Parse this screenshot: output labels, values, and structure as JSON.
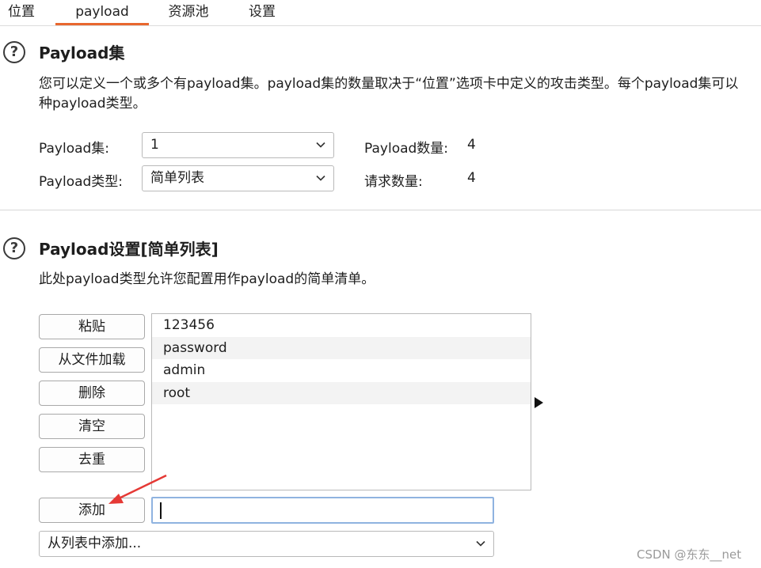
{
  "tabs": [
    {
      "label": "位置",
      "active": false
    },
    {
      "label": "payload",
      "active": true
    },
    {
      "label": "资源池",
      "active": false
    },
    {
      "label": "设置",
      "active": false
    }
  ],
  "payload_sets": {
    "title": "Payload集",
    "description_line1": "您可以定义一个或多个有payload集。payload集的数量取决于“位置”选项卡中定义的攻击类型。每个payload集可以",
    "description_line2": "种payload类型。",
    "set_label": "Payload集:",
    "set_value": "1",
    "type_label": "Payload类型:",
    "type_value": "简单列表",
    "count_label": "Payload数量:",
    "count_value": "4",
    "requests_label": "请求数量:",
    "requests_value": "4"
  },
  "payload_settings": {
    "title": "Payload设置[简单列表]",
    "description": "此处payload类型允许您配置用作payload的简单清单。",
    "buttons": {
      "paste": "粘贴",
      "load": "从文件加载",
      "remove": "删除",
      "clear": "清空",
      "dedupe": "去重",
      "add": "添加"
    },
    "items": [
      "123456",
      "password",
      "admin",
      "root"
    ],
    "add_input_value": "",
    "add_from_list": "从列表中添加..."
  },
  "watermark": "CSDN @东东__net",
  "colors": {
    "accent_tab": "#e8672e",
    "annotation_arrow": "#e53935",
    "input_focus": "#8fb3e0"
  }
}
